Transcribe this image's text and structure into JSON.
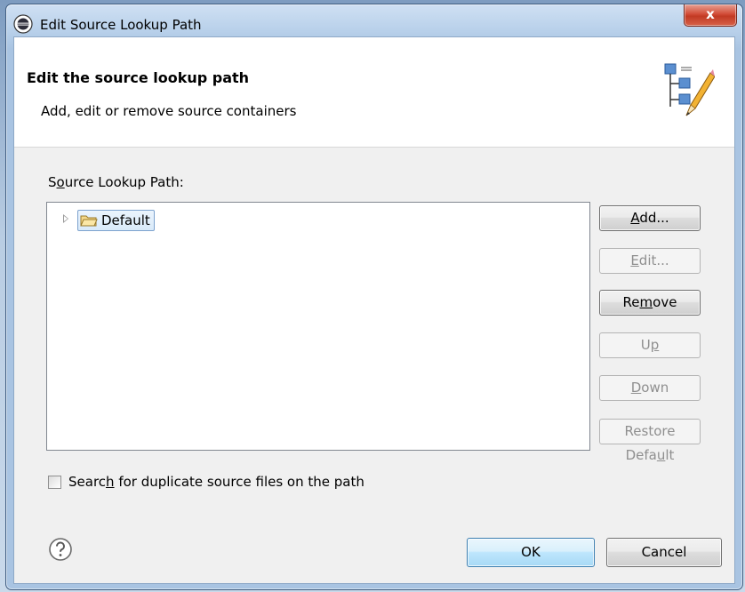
{
  "window": {
    "title": "Edit Source Lookup Path",
    "close_label": "x"
  },
  "header": {
    "title": "Edit the source lookup path",
    "subtitle": "Add, edit or remove source containers",
    "icon": "source-lookup-edit-icon"
  },
  "source_list": {
    "label_pre": "S",
    "label_mnemonic": "o",
    "label_post": "urce Lookup Path:",
    "items": [
      {
        "label": "Default",
        "icon": "folder-open-icon",
        "selected": true,
        "expanded": false
      }
    ]
  },
  "buttons": {
    "add": {
      "pre": "",
      "mn": "A",
      "post": "dd...",
      "enabled": true
    },
    "edit": {
      "pre": "",
      "mn": "E",
      "post": "dit...",
      "enabled": false
    },
    "remove": {
      "pre": "Re",
      "mn": "m",
      "post": "ove",
      "enabled": true
    },
    "up": {
      "pre": "U",
      "mn": "p",
      "post": "",
      "enabled": false
    },
    "down": {
      "pre": "",
      "mn": "D",
      "post": "own",
      "enabled": false
    },
    "restore": {
      "pre": "Restore Defa",
      "mn": "u",
      "post": "lt",
      "enabled": false
    }
  },
  "duplicate_search": {
    "pre": "Searc",
    "mn": "h",
    "post": " for duplicate source files on the path",
    "checked": false
  },
  "footer": {
    "ok_label": "OK",
    "cancel_label": "Cancel",
    "help_icon": "help-icon"
  },
  "colors": {
    "close_button": "#c23a23",
    "selection_border": "#7da2ce",
    "default_button_border": "#3c7fb1",
    "disabled_text": "#8f8f8f"
  }
}
